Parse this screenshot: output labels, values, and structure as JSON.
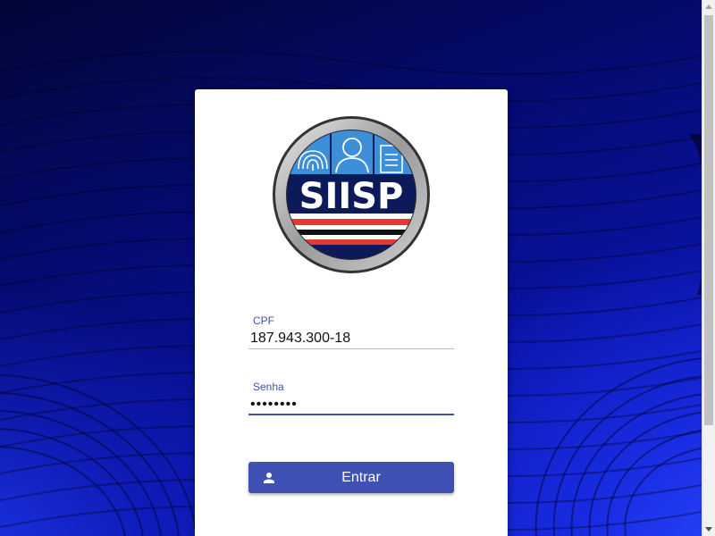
{
  "app": {
    "logo_text": "SIISP",
    "logo_icon": "siisp-seal-logo"
  },
  "form": {
    "cpf": {
      "label": "CPF",
      "value": "187.943.300-18"
    },
    "senha": {
      "label": "Senha",
      "value": "********"
    },
    "submit": {
      "label": "Entrar",
      "icon": "person-icon"
    }
  },
  "colors": {
    "primary": "#3f51b5",
    "background": "#0a14a8"
  }
}
